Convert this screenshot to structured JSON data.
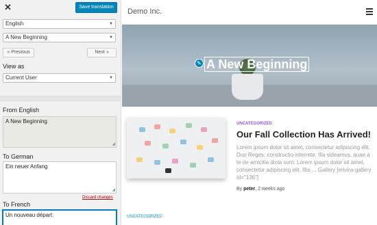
{
  "panel": {
    "close_label": "✕",
    "save_label": "Save translation",
    "language_select": "English",
    "string_select": "A New Beginning",
    "previous_label": "« Previous",
    "next_label": "Next »",
    "view_as_label": "View as",
    "view_as_select": "Current User",
    "from_label": "From English",
    "from_value": "A New Beginning",
    "to_german_label": "To German",
    "to_german_value": "Ein neuer Anfang",
    "discard_label": "Discard changes",
    "to_french_label": "To French",
    "to_french_value": "Un nouveau départ"
  },
  "preview": {
    "site_title": "Demo Inc.",
    "hero_title": "A New Beginning",
    "post": {
      "category": "UNCATEGORIZED",
      "title": "Our Fall Collection Has Arrived!",
      "excerpt": "Lorem ipsum dolor sit amet, consectetur adipiscing elit. Duo Reges: constructio interrete. Illa videamus, quae a te de amicitia dicta sunt. Lorem ipsum dolor sit amet, consectetur adipiscing elit. Illis ... Gallery [envira-gallery id=\"136\"]",
      "meta_prefix": "By ",
      "author": "peter",
      "date": ", 2 weeks ago"
    },
    "next_category": "UNCATEGORIZED"
  }
}
